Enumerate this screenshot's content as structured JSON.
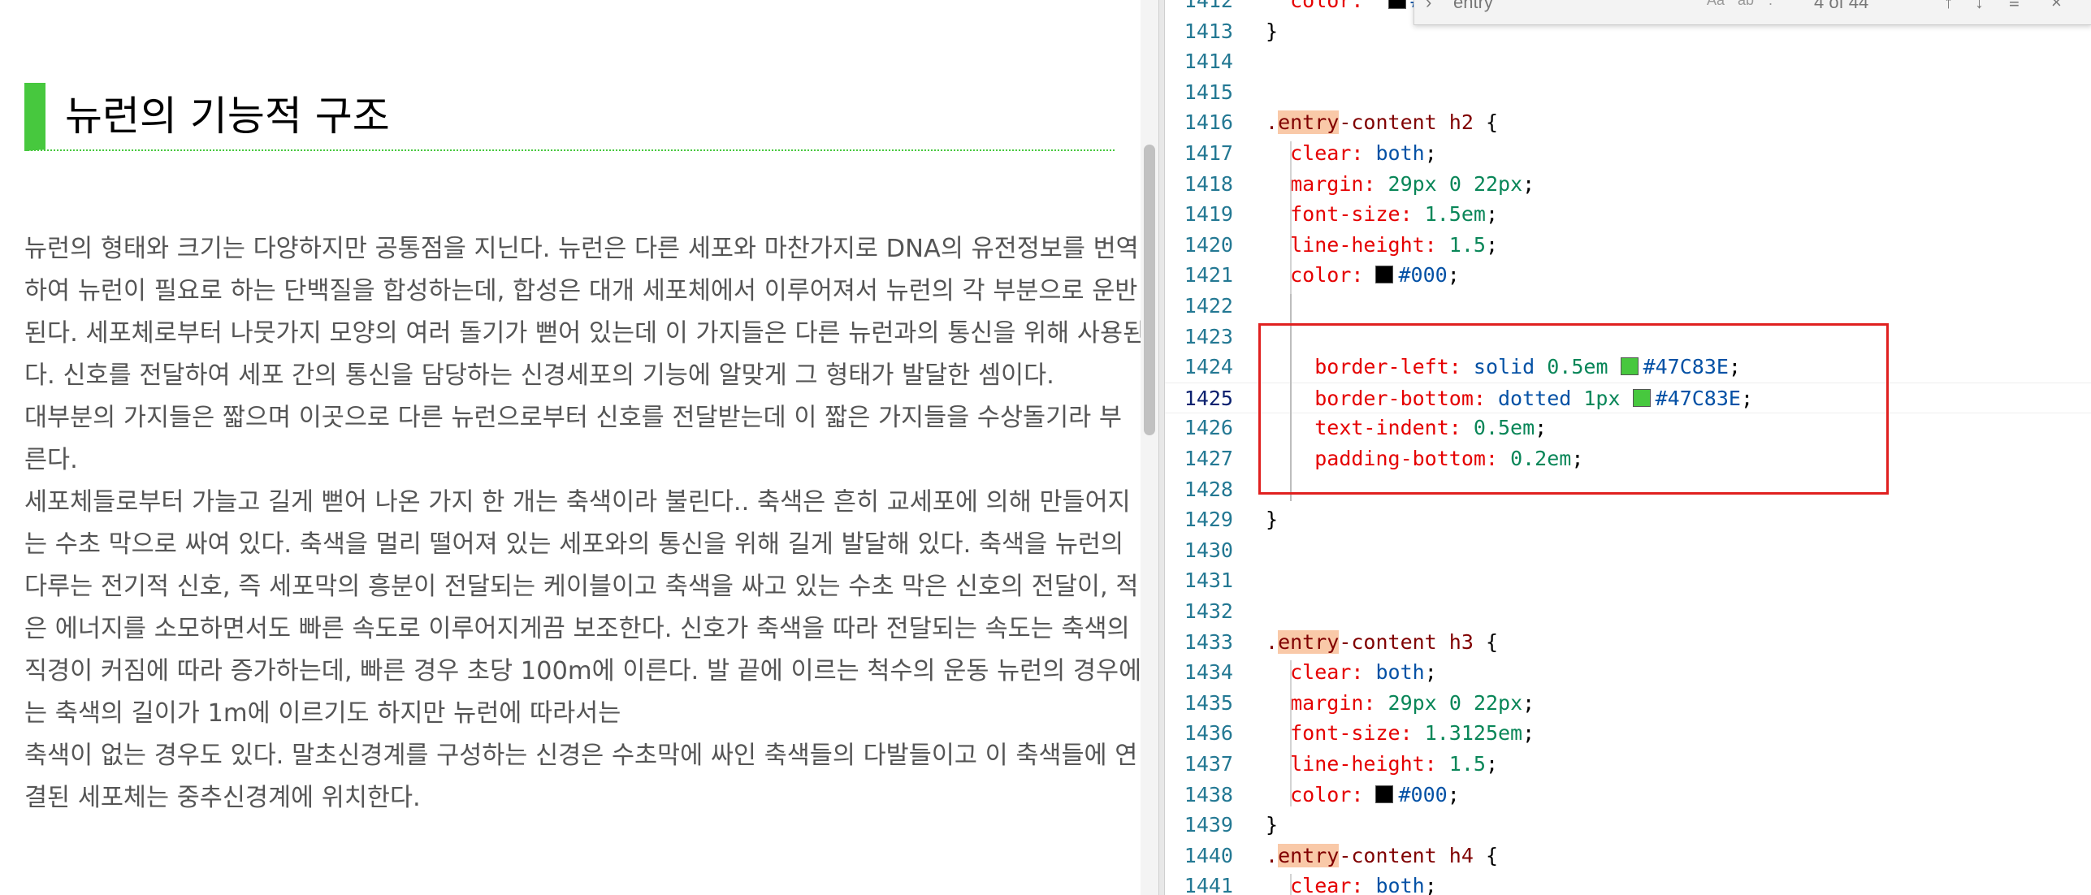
{
  "preview": {
    "heading": "뉴런의 기능적 구조",
    "paragraph_lines": [
      "뉴런의 형태와 크기는 다양하지만 공통점을 지닌다. 뉴런은 다른 세포와 마찬가지로 DNA의 유전정보를 번역",
      "하여 뉴런이 필요로 하는 단백질을 합성하는데, 합성은 대개 세포체에서 이루어져서 뉴런의 각 부분으로 운반",
      "된다. 세포체로부터 나뭇가지 모양의 여러 돌기가 뻗어 있는데 이 가지들은 다른 뉴런과의 통신을 위해 사용된",
      "다. 신호를 전달하여 세포 간의 통신을 담당하는 신경세포의 기능에 알맞게 그 형태가 발달한 셈이다.",
      "대부분의 가지들은 짧으며 이곳으로 다른 뉴런으로부터 신호를 전달받는데 이 짧은 가지들을 수상돌기라 부",
      "른다.",
      "세포체들로부터 가늘고 길게 뻗어 나온 가지 한 개는 축색이라 불린다.. 축색은 흔히 교세포에 의해 만들어지",
      "는 수초 막으로 싸여 있다. 축색을 멀리 떨어져 있는 세포와의 통신을 위해 길게 발달해 있다. 축색을 뉴런의",
      "다루는 전기적 신호, 즉 세포막의 흥분이 전달되는 케이블이고 축색을 싸고 있는 수초 막은 신호의 전달이, 적",
      "은 에너지를 소모하면서도 빠른 속도로 이루어지게끔 보조한다. 신호가 축색을 따라 전달되는 속도는 축색의",
      "직경이 커짐에 따라 증가하는데, 빠른 경우 초당 100m에 이른다. 발 끝에 이르는 척수의 운동 뉴런의 경우에",
      "는 축색의 길이가 1m에 이르기도 하지만 뉴런에 따라서는",
      "축색이 없는 경우도 있다. 말초신경계를 구성하는 신경은 수초막에 싸인 축색들의 다발들이고 이 축색들에 연",
      "결된 세포체는 중추신경계에 위치한다."
    ]
  },
  "find_widget": {
    "query": "entry",
    "count": "4 of 44",
    "options": [
      "Aa",
      "ab",
      ".*"
    ]
  },
  "editor": {
    "accent_color": "#47C83E",
    "lines": [
      {
        "n": "1412",
        "text": "  color: ■ #"
      },
      {
        "n": "1413",
        "text": "}"
      },
      {
        "n": "1414",
        "text": ""
      },
      {
        "n": "1415",
        "text": ""
      },
      {
        "n": "1416",
        "text": ".entry-content h2 {"
      },
      {
        "n": "1417",
        "text": "  clear: both;"
      },
      {
        "n": "1418",
        "text": "  margin: 29px 0 22px;"
      },
      {
        "n": "1419",
        "text": "  font-size: 1.5em;"
      },
      {
        "n": "1420",
        "text": "  line-height: 1.5;"
      },
      {
        "n": "1421",
        "text": "  color: #000;"
      },
      {
        "n": "1422",
        "text": ""
      },
      {
        "n": "1423",
        "text": ""
      },
      {
        "n": "1424",
        "text": "    border-left: solid 0.5em #47C83E;"
      },
      {
        "n": "1425",
        "text": "    border-bottom: dotted 1px #47C83E;"
      },
      {
        "n": "1426",
        "text": "    text-indent: 0.5em;"
      },
      {
        "n": "1427",
        "text": "    padding-bottom: 0.2em;"
      },
      {
        "n": "1428",
        "text": ""
      },
      {
        "n": "1429",
        "text": "}"
      },
      {
        "n": "1430",
        "text": ""
      },
      {
        "n": "1431",
        "text": ""
      },
      {
        "n": "1432",
        "text": ""
      },
      {
        "n": "1433",
        "text": ".entry-content h3 {"
      },
      {
        "n": "1434",
        "text": "  clear: both;"
      },
      {
        "n": "1435",
        "text": "  margin: 29px 0 22px;"
      },
      {
        "n": "1436",
        "text": "  font-size: 1.3125em;"
      },
      {
        "n": "1437",
        "text": "  line-height: 1.5;"
      },
      {
        "n": "1438",
        "text": "  color: #000;"
      },
      {
        "n": "1439",
        "text": "}"
      },
      {
        "n": "1440",
        "text": ".entry-content h4 {"
      },
      {
        "n": "1441",
        "text": "  clear: both;"
      }
    ]
  }
}
